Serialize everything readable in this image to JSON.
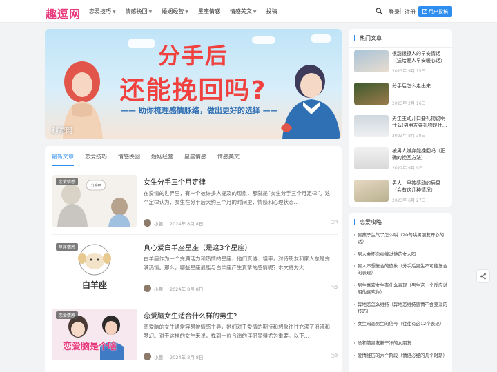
{
  "header": {
    "logo": "趣逗网",
    "nav": [
      {
        "label": "恋爱技巧",
        "dropdown": true
      },
      {
        "label": "情感挽回",
        "dropdown": true
      },
      {
        "label": "婚姻经营",
        "dropdown": true
      },
      {
        "label": "星座情感",
        "dropdown": false
      },
      {
        "label": "情感美文",
        "dropdown": true
      },
      {
        "label": "投稿",
        "dropdown": false
      }
    ],
    "login": "登录",
    "register": "注册",
    "post_button": "用户投稿"
  },
  "banner": {
    "line1": "分手后",
    "line2": "还能挽回吗?",
    "line3": "—— 助你梳理感情脉络，做出更好的选择 ——",
    "caption": "趣逗网"
  },
  "tabs": [
    "最新文章",
    "恋爱技巧",
    "情感挽回",
    "婚姻经营",
    "星座情感",
    "情感美文"
  ],
  "posts": [
    {
      "badge": "恋爱情感",
      "title": "女生分手三个月定律",
      "excerpt": "在爱情的世界里，有一个被许多人提及的现象，那就是“女生分手三个月定律”。这个定律认为，女生在分手后大约三个月的时间里，情感和心理状态…",
      "author": "小趣",
      "date": "2024年 8月 8日",
      "comments": "0"
    },
    {
      "badge": "星座情感",
      "title": "真心爱白羊座星座（是这3个星座）",
      "excerpt": "白羊座作为一个充满活力和热情的星座，他们真诚、坦率，对待朋友和家人总是充满热情。那么，哪些星座最能与白羊座产生真挚的感情呢？本文将为大…",
      "author": "小趣",
      "date": "2024年 8月 8日",
      "comments": "0",
      "thumb_text": "白羊座"
    },
    {
      "badge": "恋爱情感",
      "title": "恋爱脑女生适合什么样的男生?",
      "excerpt": "恋爱脑的女生通常容易被情感主导，她们对于爱情的期待和想象往往充满了浪漫和梦幻。对于这样的女生来说，找到一位合适的伴侣显得尤为重要。以下…",
      "author": "小趣",
      "date": "2024年 8月 8日",
      "comments": "0",
      "thumb_text": "恋爱脑是个啥"
    }
  ],
  "sidebar": {
    "hot_title": "热门文章",
    "hot": [
      {
        "title": "很甜很撩人的早安情话（送给爱人早安暖心话）",
        "date": "2023年 9月 15日"
      },
      {
        "title": "分手后怎么走出来",
        "date": "2023年 2月 16日"
      },
      {
        "title": "男生主动开口要礼物说明什么(男朋友要礼物是什…",
        "date": "2023年 8月 30日"
      },
      {
        "title": "被男人嫌弃能挽回吗（正确的挽回方法）",
        "date": "2022年 9月 9日"
      },
      {
        "title": "男人一旦被感动的后果（会有这几种情况）",
        "date": "2023年 6月 27日"
      }
    ],
    "love_title": "恋爱攻略",
    "love": [
      "男孩子生气了怎么哄（20句哄男朋友开心的话）",
      "男人会怀念纠缠过他的女人吗",
      "男人不想复合的迹象（分手后男生不可能复合的表现）",
      "男生喜欢女生有什么表现（男生这十个反应说明他喜欢你）",
      "异地恋怎么维持（异地恋维持感情不会变淡的技巧）",
      "女生暗恋男生的信号（往往有这12个表现）",
      "没和前男友断干净的女朋友",
      "爱情经历的六个阶段（情侣必经的几个时期）"
    ]
  },
  "colors": {
    "brand": "#e8397c",
    "accent": "#2e8ef0",
    "banner_text": "#f0413f"
  }
}
